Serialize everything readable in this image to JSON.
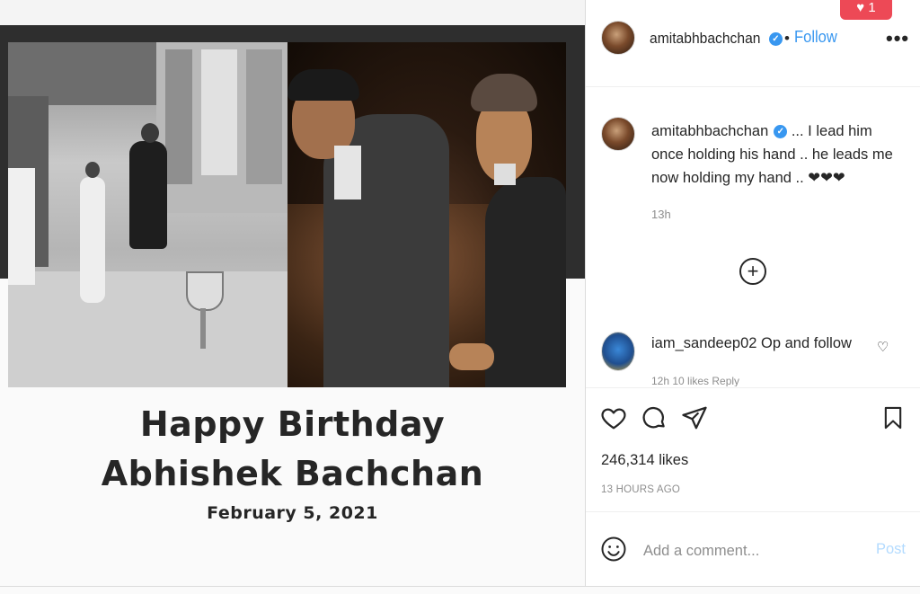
{
  "post": {
    "headline_line1": "Happy Birthday",
    "headline_line2": "Abhishek Bachchan",
    "headline_date": "February 5, 2021"
  },
  "header": {
    "username": "amitabhbachchan",
    "dot": "•",
    "follow_label": "Follow",
    "more_icon": "more-horizontal-icon",
    "notification_count": "1"
  },
  "caption": {
    "username": "amitabhbachchan",
    "text": " ... I lead him once holding his hand .. he leads me now holding my hand .. ❤❤❤",
    "time": "13h"
  },
  "comments": [
    {
      "username": "iam_sandeep02",
      "text": "Op and follow",
      "meta": "12h    10 likes    Reply"
    }
  ],
  "actions": {
    "likes": "246,314 likes",
    "time_ago": "13 HOURS AGO"
  },
  "add_comment": {
    "placeholder": "Add a comment...",
    "post_label": "Post"
  },
  "colors": {
    "accent": "#3897f0",
    "notification": "#ed4956",
    "post_disabled": "#b3dbff"
  }
}
